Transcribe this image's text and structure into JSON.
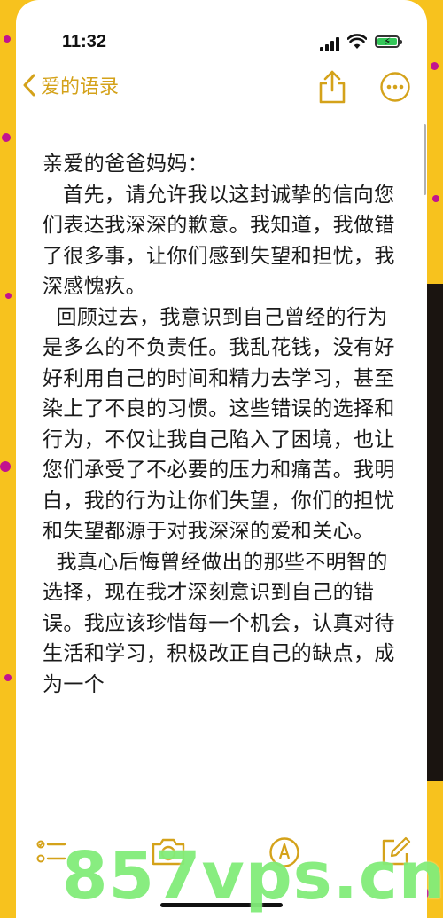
{
  "status": {
    "time": "11:32"
  },
  "nav": {
    "back_label": "爱的语录"
  },
  "note": {
    "paragraphs": [
      "亲爱的爸爸妈妈：",
      "   首先，请允许我以这封诚挚的信向您们表达我深深的歉意。我知道，我做错了很多事，让你们感到失望和担忧，我深感愧疚。",
      "  回顾过去，我意识到自己曾经的行为是多么的不负责任。我乱花钱，没有好好利用自己的时间和精力去学习，甚至染上了不良的习惯。这些错误的选择和行为，不仅让我自己陷入了困境，也让您们承受了不必要的压力和痛苦。我明白，我的行为让你们失望，你们的担忧和失望都源于对我深深的爱和关心。",
      "  我真心后悔曾经做出的那些不明智的选择，现在我才深刻意识到自己的错误。我应该珍惜每一个机会，认真对待生活和学习，积极改正自己的缺点，成为一个"
    ]
  },
  "watermark": "857vps.cn",
  "colors": {
    "accent": "#d4a21a",
    "background": "#f7c21e",
    "dots": "#c2138f"
  }
}
